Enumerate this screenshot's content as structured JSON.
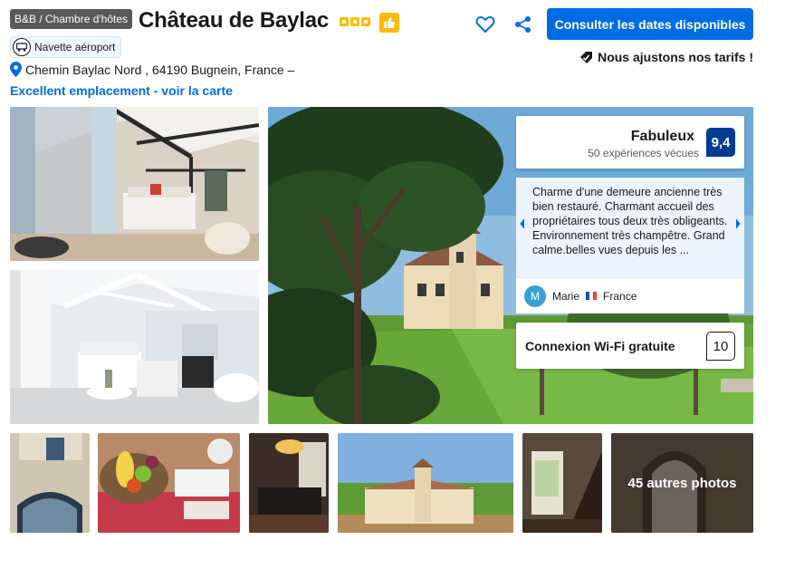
{
  "header": {
    "type_badge": "B&B / Chambre d'hôtes",
    "hotel_name": "Château de Baylac",
    "star_icons": 3,
    "cta_label": "Consulter les dates disponibles",
    "shuttle_label": "Navette aéroport",
    "price_match": "Nous ajustons nos tarifs !",
    "address": "Chemin Baylac Nord , 64190 Bugnein, France –",
    "map_link": "Excellent emplacement - voir la carte"
  },
  "review": {
    "word": "Fabuleux",
    "count": "50 expériences vécues",
    "score": "9,4",
    "text": "Charme d'une demeure ancienne très bien restauré. Charmant accueil des propriétaires tous deux très obligeants. Environnement très champêtre. Grand calme.belles vues depuis les ...",
    "author_initial": "M",
    "author_name": "Marie",
    "author_country": "France"
  },
  "wifi": {
    "label": "Connexion Wi-Fi gratuite",
    "score": "10"
  },
  "gallery": {
    "more_photos": "45 autres photos"
  },
  "colors": {
    "brand_blue": "#006ce4",
    "score_blue": "#003b95",
    "star_yellow": "#febb02",
    "review_bg": "#ebf3ff"
  },
  "icons": [
    "heart-icon",
    "share-icon",
    "shuttle-icon",
    "map-pin-icon",
    "price-tag-check-icon",
    "thumbs-up-icon",
    "chevron-left-icon",
    "chevron-right-icon"
  ]
}
